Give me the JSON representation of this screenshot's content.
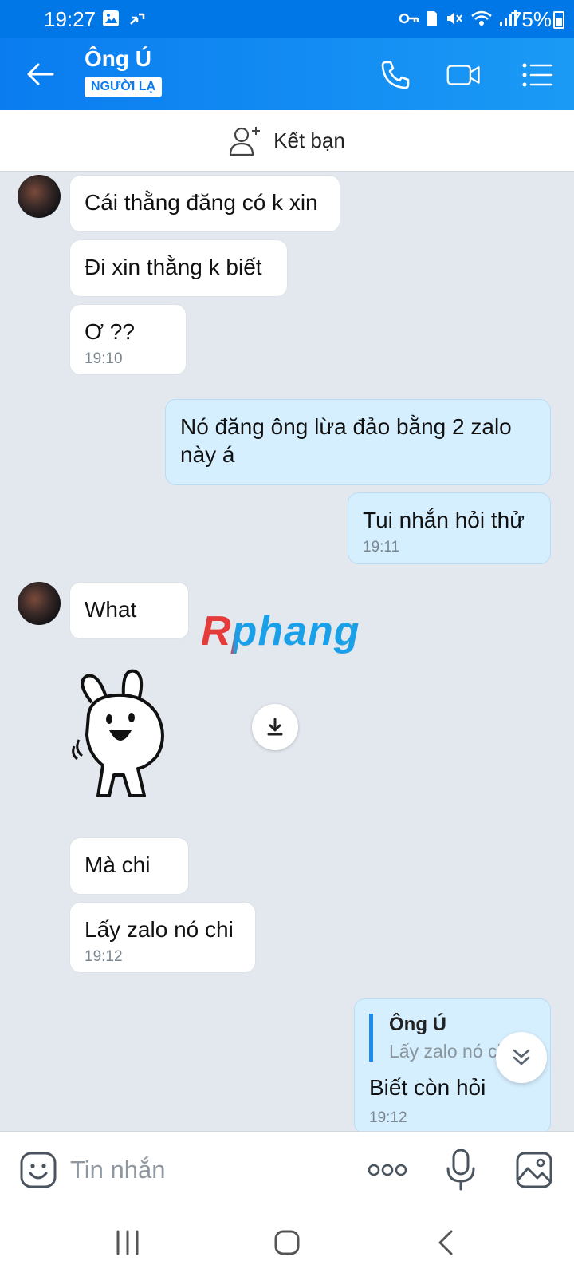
{
  "status_bar": {
    "time": "19:27",
    "battery": "75%"
  },
  "header": {
    "contact_name": "Ông Ú",
    "badge": "NGƯỜI LẠ",
    "accent_color": "#0a7cf0"
  },
  "friend_bar": {
    "label": "Kết bạn"
  },
  "messages": [
    {
      "dir": "in",
      "text": "Cái thằng đăng có k xin"
    },
    {
      "dir": "in",
      "text": "Đi xin thằng k biết"
    },
    {
      "dir": "in",
      "text": "Ơ ??",
      "time": "19:10"
    },
    {
      "dir": "out",
      "text": "Nó đăng ông lừa đảo bằng 2 zalo này á"
    },
    {
      "dir": "out",
      "text": "Tui nhắn hỏi thử",
      "time": "19:11"
    },
    {
      "dir": "in",
      "text": "What"
    },
    {
      "dir": "in",
      "text": "Mà chi"
    },
    {
      "dir": "in",
      "text": "Lấy zalo nó chi",
      "time": "19:12"
    }
  ],
  "watermark": "Rphang",
  "reply": {
    "author": "Ông Ú",
    "quoted": "Lấy zalo nó chi",
    "text": "Biết còn hỏi",
    "time": "19:12"
  },
  "input": {
    "placeholder": "Tin nhắn"
  }
}
